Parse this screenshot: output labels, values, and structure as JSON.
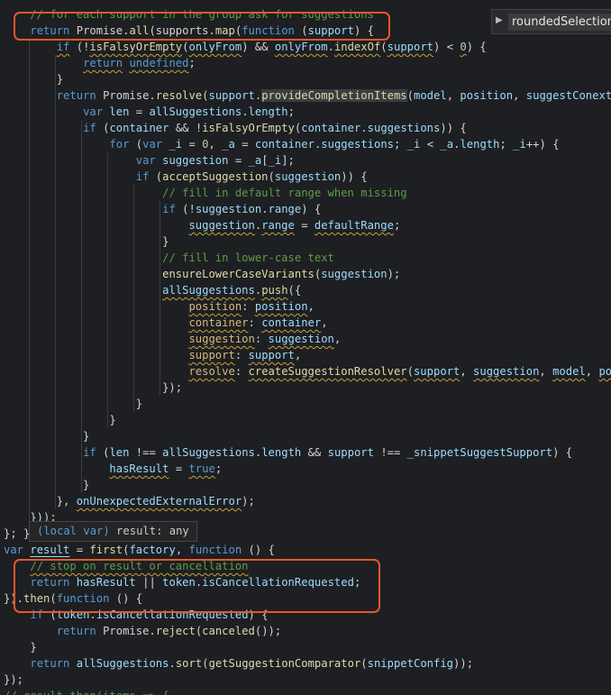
{
  "editor": {
    "lines": [
      [
        [
          "comment",
          "    // for each support in the group ask for suggestions"
        ]
      ],
      [
        [
          "plain",
          "    "
        ],
        [
          "kw",
          "return"
        ],
        [
          "plain",
          " Promise."
        ],
        [
          "fn",
          "all"
        ],
        [
          "plain",
          "(supports."
        ],
        [
          "fn",
          "map"
        ],
        [
          "plain",
          "("
        ],
        [
          "kw",
          "function"
        ],
        [
          "plain",
          " ("
        ],
        [
          "var",
          "support"
        ],
        [
          "plain",
          ") {"
        ]
      ],
      [
        [
          "plain",
          "        "
        ],
        [
          "kw",
          "if"
        ],
        [
          "plain",
          " (!"
        ],
        [
          "fn",
          "isFalsyOrEmpty"
        ],
        [
          "plain",
          "("
        ],
        [
          "var",
          "onlyFrom"
        ],
        [
          "plain",
          ") && "
        ],
        [
          "var",
          "onlyFrom"
        ],
        [
          "plain",
          "."
        ],
        [
          "fn",
          "indexOf"
        ],
        [
          "plain",
          "("
        ],
        [
          "var",
          "support"
        ],
        [
          "plain",
          ") < "
        ],
        [
          "num",
          "0"
        ],
        [
          "plain",
          ") {"
        ]
      ],
      [
        [
          "plain",
          "            "
        ],
        [
          "kw",
          "return"
        ],
        [
          "plain",
          " "
        ],
        [
          "kw",
          "undefined"
        ],
        [
          "plain",
          ";"
        ]
      ],
      [
        [
          "plain",
          "        }"
        ]
      ],
      [
        [
          "plain",
          "        "
        ],
        [
          "kw",
          "return"
        ],
        [
          "plain",
          " Promise."
        ],
        [
          "fn",
          "resolve"
        ],
        [
          "plain",
          "("
        ],
        [
          "var",
          "support"
        ],
        [
          "plain",
          "."
        ],
        [
          "fn",
          "provideCompletionItems"
        ],
        [
          "plain",
          "("
        ],
        [
          "var",
          "model"
        ],
        [
          "plain",
          ", "
        ],
        [
          "var",
          "position"
        ],
        [
          "plain",
          ", "
        ],
        [
          "var",
          "suggestConext"
        ],
        [
          "plain",
          ", "
        ]
      ],
      [
        [
          "plain",
          "            "
        ],
        [
          "kw",
          "var"
        ],
        [
          "plain",
          " "
        ],
        [
          "var",
          "len"
        ],
        [
          "plain",
          " = "
        ],
        [
          "var",
          "allSuggestions"
        ],
        [
          "plain",
          "."
        ],
        [
          "var",
          "length"
        ],
        [
          "plain",
          ";"
        ]
      ],
      [
        [
          "plain",
          "            "
        ],
        [
          "kw",
          "if"
        ],
        [
          "plain",
          " ("
        ],
        [
          "var",
          "container"
        ],
        [
          "plain",
          " && !"
        ],
        [
          "fn",
          "isFalsyOrEmpty"
        ],
        [
          "plain",
          "("
        ],
        [
          "var",
          "container"
        ],
        [
          "plain",
          "."
        ],
        [
          "var",
          "suggestions"
        ],
        [
          "plain",
          ")) {"
        ]
      ],
      [
        [
          "plain",
          "                "
        ],
        [
          "kw",
          "for"
        ],
        [
          "plain",
          " ("
        ],
        [
          "kw",
          "var"
        ],
        [
          "plain",
          " "
        ],
        [
          "var",
          "_i"
        ],
        [
          "plain",
          " = "
        ],
        [
          "num",
          "0"
        ],
        [
          "plain",
          ", "
        ],
        [
          "var",
          "_a"
        ],
        [
          "plain",
          " = "
        ],
        [
          "var",
          "container"
        ],
        [
          "plain",
          "."
        ],
        [
          "var",
          "suggestions"
        ],
        [
          "plain",
          "; "
        ],
        [
          "var",
          "_i"
        ],
        [
          "plain",
          " < "
        ],
        [
          "var",
          "_a"
        ],
        [
          "plain",
          "."
        ],
        [
          "var",
          "length"
        ],
        [
          "plain",
          "; "
        ],
        [
          "var",
          "_i"
        ],
        [
          "plain",
          "++) {"
        ]
      ],
      [
        [
          "plain",
          "                    "
        ],
        [
          "kw",
          "var"
        ],
        [
          "plain",
          " "
        ],
        [
          "var",
          "suggestion"
        ],
        [
          "plain",
          " = "
        ],
        [
          "var",
          "_a"
        ],
        [
          "plain",
          "["
        ],
        [
          "var",
          "_i"
        ],
        [
          "plain",
          "];"
        ]
      ],
      [
        [
          "plain",
          "                    "
        ],
        [
          "kw",
          "if"
        ],
        [
          "plain",
          " ("
        ],
        [
          "fn",
          "acceptSuggestion"
        ],
        [
          "plain",
          "("
        ],
        [
          "var",
          "suggestion"
        ],
        [
          "plain",
          ")) {"
        ]
      ],
      [
        [
          "plain",
          "                        "
        ],
        [
          "comment",
          "// fill in default range when missing"
        ]
      ],
      [
        [
          "plain",
          "                        "
        ],
        [
          "kw",
          "if"
        ],
        [
          "plain",
          " (!"
        ],
        [
          "var",
          "suggestion"
        ],
        [
          "plain",
          "."
        ],
        [
          "var",
          "range"
        ],
        [
          "plain",
          ") {"
        ]
      ],
      [
        [
          "plain",
          "                            "
        ],
        [
          "var",
          "suggestion"
        ],
        [
          "plain",
          "."
        ],
        [
          "var",
          "range"
        ],
        [
          "plain",
          " = "
        ],
        [
          "var",
          "defaultRange"
        ],
        [
          "plain",
          ";"
        ]
      ],
      [
        [
          "plain",
          "                        }"
        ]
      ],
      [
        [
          "plain",
          "                        "
        ],
        [
          "comment",
          "// fill in lower-case text"
        ]
      ],
      [
        [
          "plain",
          "                        "
        ],
        [
          "fn",
          "ensureLowerCaseVariants"
        ],
        [
          "plain",
          "("
        ],
        [
          "var",
          "suggestion"
        ],
        [
          "plain",
          ");"
        ]
      ],
      [
        [
          "plain",
          "                        "
        ],
        [
          "var",
          "allSuggestions"
        ],
        [
          "plain",
          "."
        ],
        [
          "fn",
          "push"
        ],
        [
          "plain",
          "({"
        ]
      ],
      [
        [
          "plain",
          "                            "
        ],
        [
          "prop",
          "position"
        ],
        [
          "plain",
          ": "
        ],
        [
          "var",
          "position"
        ],
        [
          "plain",
          ","
        ]
      ],
      [
        [
          "plain",
          "                            "
        ],
        [
          "prop",
          "container"
        ],
        [
          "plain",
          ": "
        ],
        [
          "var",
          "container"
        ],
        [
          "plain",
          ","
        ]
      ],
      [
        [
          "plain",
          "                            "
        ],
        [
          "prop",
          "suggestion"
        ],
        [
          "plain",
          ": "
        ],
        [
          "var",
          "suggestion"
        ],
        [
          "plain",
          ","
        ]
      ],
      [
        [
          "plain",
          "                            "
        ],
        [
          "prop",
          "support"
        ],
        [
          "plain",
          ": "
        ],
        [
          "var",
          "support"
        ],
        [
          "plain",
          ","
        ]
      ],
      [
        [
          "plain",
          "                            "
        ],
        [
          "prop",
          "resolve"
        ],
        [
          "plain",
          ": "
        ],
        [
          "fn",
          "createSuggestionResolver"
        ],
        [
          "plain",
          "("
        ],
        [
          "var",
          "support"
        ],
        [
          "plain",
          ", "
        ],
        [
          "var",
          "suggestion"
        ],
        [
          "plain",
          ", "
        ],
        [
          "var",
          "model"
        ],
        [
          "plain",
          ", "
        ],
        [
          "var",
          "posi"
        ]
      ],
      [
        [
          "plain",
          "                        });"
        ]
      ],
      [
        [
          "plain",
          "                    }"
        ]
      ],
      [
        [
          "plain",
          "                }"
        ]
      ],
      [
        [
          "plain",
          "            }"
        ]
      ],
      [
        [
          "plain",
          "            "
        ],
        [
          "kw",
          "if"
        ],
        [
          "plain",
          " ("
        ],
        [
          "var",
          "len"
        ],
        [
          "plain",
          " !== "
        ],
        [
          "var",
          "allSuggestions"
        ],
        [
          "plain",
          "."
        ],
        [
          "var",
          "length"
        ],
        [
          "plain",
          " && "
        ],
        [
          "var",
          "support"
        ],
        [
          "plain",
          " !== "
        ],
        [
          "var",
          "_snippetSuggestSupport"
        ],
        [
          "plain",
          ") {"
        ]
      ],
      [
        [
          "plain",
          "                "
        ],
        [
          "var",
          "hasResult"
        ],
        [
          "plain",
          " = "
        ],
        [
          "kw",
          "true"
        ],
        [
          "plain",
          ";"
        ]
      ],
      [
        [
          "plain",
          "            }"
        ]
      ],
      [
        [
          "plain",
          "        }, "
        ],
        [
          "var",
          "onUnexpectedExternalError"
        ],
        [
          "plain",
          ");"
        ]
      ],
      [
        [
          "plain",
          "    }));"
        ]
      ],
      [
        [
          "plain",
          "}; }"
        ]
      ],
      [
        [
          "kw",
          "var"
        ],
        [
          "plain",
          " "
        ],
        [
          "var",
          "result"
        ],
        [
          "plain",
          " = "
        ],
        [
          "fn",
          "first"
        ],
        [
          "plain",
          "("
        ],
        [
          "var",
          "factory"
        ],
        [
          "plain",
          ", "
        ],
        [
          "kw",
          "function"
        ],
        [
          "plain",
          " () {"
        ]
      ],
      [
        [
          "plain",
          "    "
        ],
        [
          "comment",
          "// stop on result or cancellation"
        ]
      ],
      [
        [
          "plain",
          "    "
        ],
        [
          "kw",
          "return"
        ],
        [
          "plain",
          " "
        ],
        [
          "var",
          "hasResult"
        ],
        [
          "plain",
          " || "
        ],
        [
          "var",
          "token"
        ],
        [
          "plain",
          "."
        ],
        [
          "var",
          "isCancellationRequested"
        ],
        [
          "plain",
          ";"
        ]
      ],
      [
        [
          "plain",
          "})."
        ],
        [
          "fn",
          "then"
        ],
        [
          "plain",
          "("
        ],
        [
          "kw",
          "function"
        ],
        [
          "plain",
          " () {"
        ]
      ],
      [
        [
          "plain",
          "    "
        ],
        [
          "kw",
          "if"
        ],
        [
          "plain",
          " ("
        ],
        [
          "var",
          "token"
        ],
        [
          "plain",
          "."
        ],
        [
          "var",
          "isCancellationRequested"
        ],
        [
          "plain",
          ") {"
        ]
      ],
      [
        [
          "plain",
          "        "
        ],
        [
          "kw",
          "return"
        ],
        [
          "plain",
          " Promise."
        ],
        [
          "fn",
          "reject"
        ],
        [
          "plain",
          "("
        ],
        [
          "fn",
          "canceled"
        ],
        [
          "plain",
          "());"
        ]
      ],
      [
        [
          "plain",
          "    }"
        ]
      ],
      [
        [
          "plain",
          "    "
        ],
        [
          "kw",
          "return"
        ],
        [
          "plain",
          " "
        ],
        [
          "var",
          "allSuggestions"
        ],
        [
          "plain",
          "."
        ],
        [
          "fn",
          "sort"
        ],
        [
          "plain",
          "("
        ],
        [
          "fn",
          "getSuggestionComparator"
        ],
        [
          "plain",
          "("
        ],
        [
          "var",
          "snippetConfig"
        ],
        [
          "plain",
          "));"
        ]
      ],
      [
        [
          "plain",
          "});"
        ]
      ],
      [
        [
          "comment",
          "// result.then(items => {"
        ]
      ]
    ]
  },
  "hover": {
    "prefix": "(local var)",
    "text": " result: any"
  },
  "peek": {
    "label": "roundedSelection",
    "chevron_icon": "chevron-right-icon"
  },
  "colors": {
    "background": "#1e1f22",
    "annotation_red": "#e8572c"
  }
}
